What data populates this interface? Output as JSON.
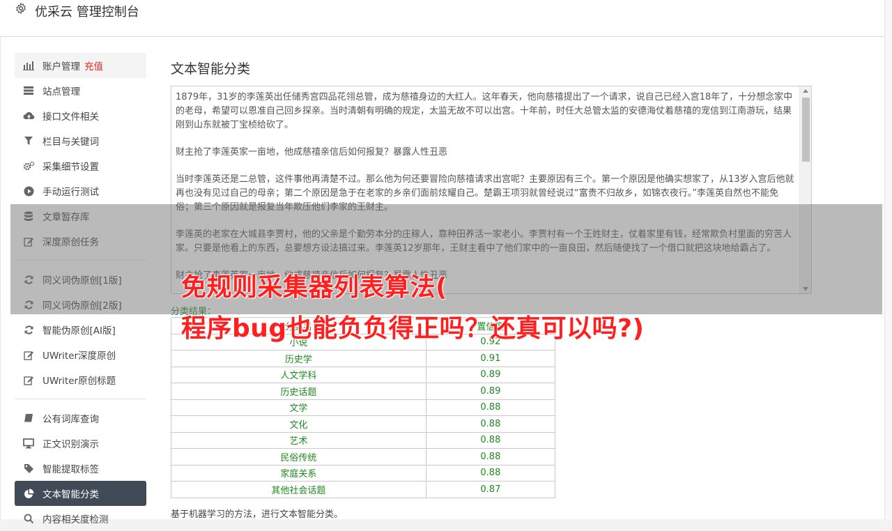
{
  "header": {
    "title": "优采云 管理控制台"
  },
  "sidebar": {
    "groups": [
      [
        {
          "icon": "bar-chart-icon",
          "label": "账户管理",
          "extra": "充值",
          "highlight": true
        },
        {
          "icon": "server-icon",
          "label": "站点管理"
        },
        {
          "icon": "cloud-upload-icon",
          "label": "接口文件相关"
        },
        {
          "icon": "filter-icon",
          "label": "栏目与关键词"
        },
        {
          "icon": "cogs-icon",
          "label": "采集细节设置"
        },
        {
          "icon": "play-circle-icon",
          "label": "手动运行测试"
        },
        {
          "icon": "database-icon",
          "label": "文章暂存库"
        },
        {
          "icon": "edit-icon",
          "label": "深度原创任务"
        }
      ],
      [
        {
          "icon": "refresh-icon",
          "label": "同义词伪原创[1版]"
        },
        {
          "icon": "refresh-icon",
          "label": "同义词伪原创[2版]"
        },
        {
          "icon": "refresh-icon",
          "label": "智能伪原创[AI版]"
        },
        {
          "icon": "edit-icon",
          "label": "UWriter深度原创"
        },
        {
          "icon": "edit-icon",
          "label": "UWriter原创标题"
        }
      ],
      [
        {
          "icon": "book-icon",
          "label": "公有词库查询"
        },
        {
          "icon": "monitor-icon",
          "label": "正文识别演示"
        },
        {
          "icon": "tag-icon",
          "label": "智能提取标签"
        },
        {
          "icon": "pie-chart-icon",
          "label": "文本智能分类",
          "active": true
        },
        {
          "icon": "search-icon",
          "label": "内容相关度检测"
        }
      ]
    ]
  },
  "main": {
    "title": "文本智能分类",
    "article": [
      "1879年，31岁的李莲英出任储秀宫四品花翎总管，成为慈禧身边的大红人。这年春天，他向慈禧提出了一个请求，说自己已经入宫18年了，十分想念家中的老母，希望可以恩准自己回乡探亲。当时清朝有明确的规定，太监无故不可以出宫。十年前，时任大总管太监的安德海仗着慈禧的宠信到江南游玩，结果刚到山东就被丁宝桢给砍了。",
      "财主抢了李莲英家一亩地，他成慈禧亲信后如何报复？暴露人性丑恶",
      "当时李莲英还是二总管，这件事他再清楚不过。那么他为何还要冒险向慈禧请求出宫呢？主要原因有三个。第一个原因是他确实想家了，从13岁入宫后他就再也没有见过自己的母亲；第二个原因是急于在老家的乡亲们面前炫耀自己。楚霸王项羽就曾经说过“富贵不归故乡，如锦衣夜行。”李莲英自然也不能免俗；第三个原因就是报复当年欺压他们李家的王财主。",
      "李莲英的老家在大城县李贾村，他的父亲是个勤劳本分的庄稼人，靠种田养活一家老小。李贾村有一个王姓财主，仗着家里有钱，经常欺负村里面的穷苦人家。只要是他看上的东西，总要想方设法搞过来。李莲英12岁那年，王财主看中了他们家中的一亩良田，然后随便找了一个借口就把这块地给霸占了。",
      "财主抢了李莲英家一亩地，他成慈禧亲信后如何报复？暴露人性丑恶"
    ],
    "result_label": "分类结果：",
    "table": {
      "headers": [
        "分类名",
        "置信度"
      ],
      "rows": [
        [
          "小说",
          "0.92"
        ],
        [
          "历史学",
          "0.91"
        ],
        [
          "人文学科",
          "0.89"
        ],
        [
          "历史话题",
          "0.89"
        ],
        [
          "文学",
          "0.88"
        ],
        [
          "文化",
          "0.88"
        ],
        [
          "艺术",
          "0.88"
        ],
        [
          "民俗传统",
          "0.88"
        ],
        [
          "家庭关系",
          "0.88"
        ],
        [
          "其他社会话题",
          "0.87"
        ]
      ]
    },
    "footnote": "基于机器学习的方法，进行文本智能分类。"
  },
  "watermark": {
    "line1": "免规则采集器列表算法(",
    "line2": "程序bug也能负负得正吗？还真可以吗?)"
  }
}
